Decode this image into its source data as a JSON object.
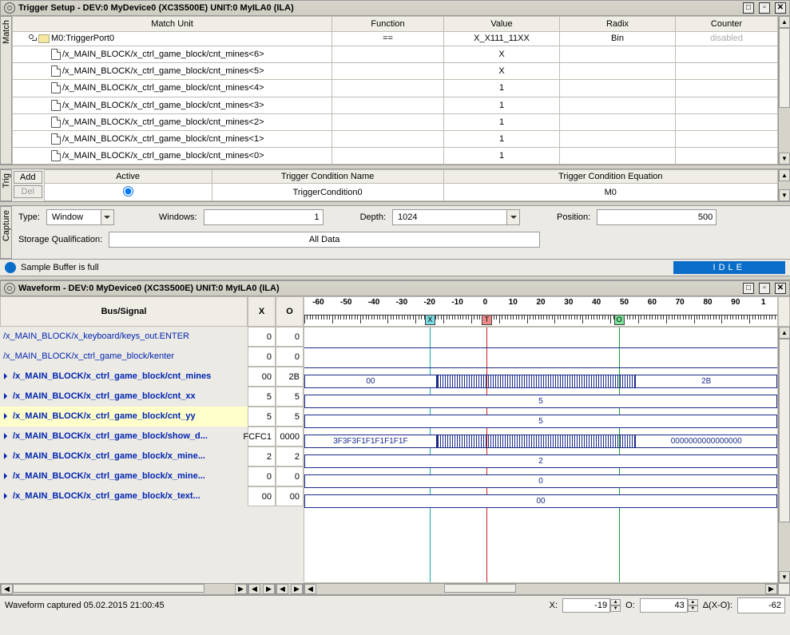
{
  "trigger_panel": {
    "title": "Trigger Setup - DEV:0 MyDevice0 (XC3S500E) UNIT:0 MyILA0 (ILA)",
    "sidetab": "Match",
    "columns": {
      "match_unit": "Match Unit",
      "function": "Function",
      "value": "Value",
      "radix": "Radix",
      "counter": "Counter"
    },
    "root": {
      "label": "M0:TriggerPort0",
      "function": "==",
      "value": "X_X111_11XX",
      "radix": "Bin",
      "counter": "disabled"
    },
    "rows": [
      {
        "label": "/x_MAIN_BLOCK/x_ctrl_game_block/cnt_mines<6>",
        "value": "X"
      },
      {
        "label": "/x_MAIN_BLOCK/x_ctrl_game_block/cnt_mines<5>",
        "value": "X"
      },
      {
        "label": "/x_MAIN_BLOCK/x_ctrl_game_block/cnt_mines<4>",
        "value": "1"
      },
      {
        "label": "/x_MAIN_BLOCK/x_ctrl_game_block/cnt_mines<3>",
        "value": "1"
      },
      {
        "label": "/x_MAIN_BLOCK/x_ctrl_game_block/cnt_mines<2>",
        "value": "1"
      },
      {
        "label": "/x_MAIN_BLOCK/x_ctrl_game_block/cnt_mines<1>",
        "value": "1"
      },
      {
        "label": "/x_MAIN_BLOCK/x_ctrl_game_block/cnt_mines<0>",
        "value": "1"
      }
    ]
  },
  "trig_cond": {
    "sidetab": "Trig",
    "add": "Add",
    "del": "Del",
    "active_hdr": "Active",
    "name_hdr": "Trigger Condition Name",
    "eq_hdr": "Trigger Condition Equation",
    "name_val": "TriggerCondition0",
    "eq_val": "M0"
  },
  "capture": {
    "sidetab": "Capture",
    "type_label": "Type:",
    "type_value": "Window",
    "windows_label": "Windows:",
    "windows_value": "1",
    "depth_label": "Depth:",
    "depth_value": "1024",
    "position_label": "Position:",
    "position_value": "500",
    "storage_label": "Storage Qualification:",
    "storage_value": "All Data",
    "buffer_status": "Sample Buffer is full",
    "idle": "IDLE"
  },
  "waveform_panel": {
    "title": "Waveform - DEV:0 MyDevice0 (XC3S500E) UNIT:0 MyILA0 (ILA)",
    "col_bus": "Bus/Signal",
    "col_x": "X",
    "col_o": "O",
    "ruler": [
      "-60",
      "-50",
      "-40",
      "-30",
      "-20",
      "-10",
      "0",
      "10",
      "20",
      "30",
      "40",
      "50",
      "60",
      "70",
      "80",
      "90",
      "1"
    ],
    "signals": [
      {
        "name": "/x_MAIN_BLOCK/x_keyboard/keys_out.ENTER",
        "x": "0",
        "o": "0",
        "bus": false,
        "hl": false
      },
      {
        "name": "/x_MAIN_BLOCK/x_ctrl_game_block/kenter",
        "x": "0",
        "o": "0",
        "bus": false,
        "hl": false
      },
      {
        "name": "/x_MAIN_BLOCK/x_ctrl_game_block/cnt_mines",
        "x": "00",
        "o": "2B",
        "bus": true,
        "hl": false,
        "seg0": "00",
        "seg1": "2B"
      },
      {
        "name": "/x_MAIN_BLOCK/x_ctrl_game_block/cnt_xx",
        "x": "5",
        "o": "5",
        "bus": true,
        "hl": false,
        "flat": "5"
      },
      {
        "name": "/x_MAIN_BLOCK/x_ctrl_game_block/cnt_yy",
        "x": "5",
        "o": "5",
        "bus": true,
        "hl": true,
        "flat": "5"
      },
      {
        "name": "/x_MAIN_BLOCK/x_ctrl_game_block/show_d...",
        "x": "FCFC1",
        "o": "0000",
        "bus": true,
        "hl": false,
        "seg0": "3F3F3F1F1F1F1F1F",
        "seg1": "0000000000000000"
      },
      {
        "name": "/x_MAIN_BLOCK/x_ctrl_game_block/x_mine...",
        "x": "2",
        "o": "2",
        "bus": true,
        "hl": false,
        "flat": "2"
      },
      {
        "name": "/x_MAIN_BLOCK/x_ctrl_game_block/x_mine...",
        "x": "0",
        "o": "0",
        "bus": true,
        "hl": false,
        "flat": "0"
      },
      {
        "name": "/x_MAIN_BLOCK/x_ctrl_game_block/x_text...",
        "x": "00",
        "o": "00",
        "bus": true,
        "hl": false,
        "flat": "00"
      }
    ],
    "cursors": {
      "x_pct": 26.5,
      "t_pct": 38.5,
      "o_pct": 66.5
    }
  },
  "footer": {
    "status": "Waveform captured 05.02.2015 21:00:45",
    "x_label": "X:",
    "x_val": "-19",
    "o_label": "O:",
    "o_val": "43",
    "d_label": "Δ(X-O):",
    "d_val": "-62"
  }
}
